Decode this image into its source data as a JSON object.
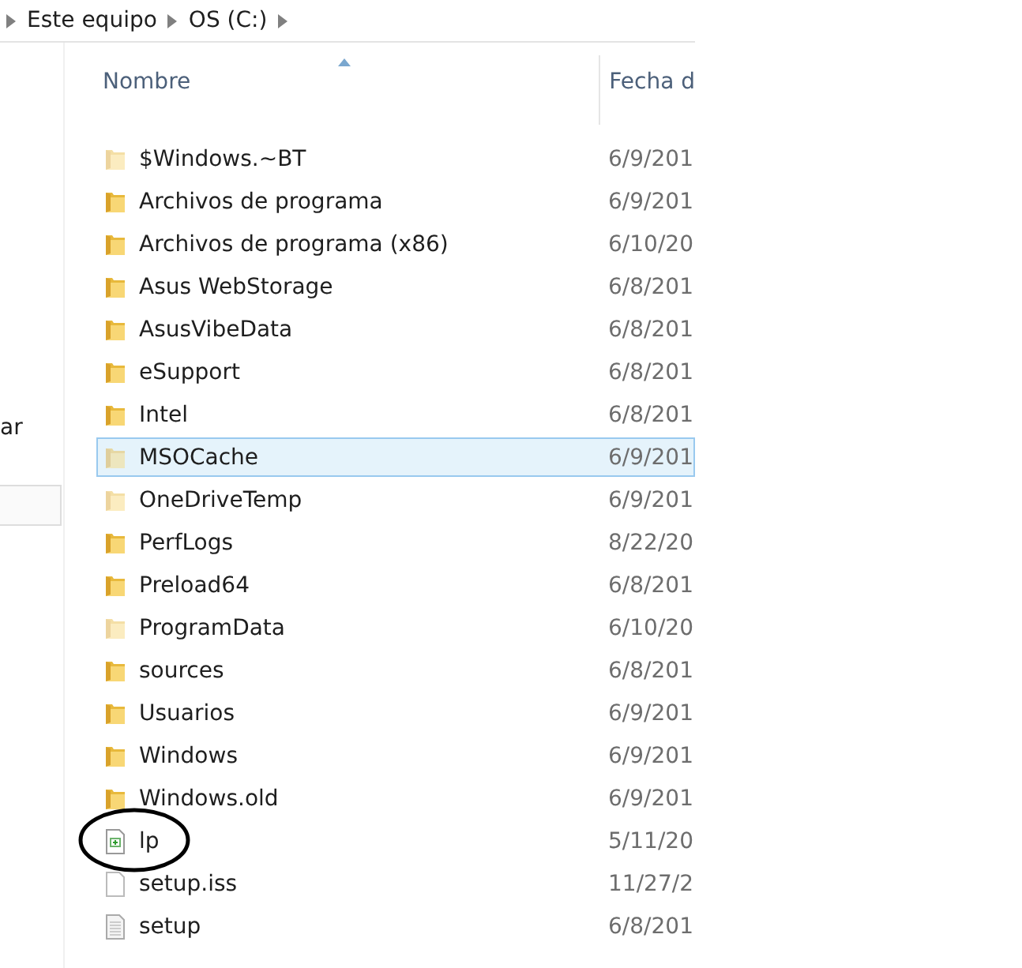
{
  "breadcrumb": [
    "Este equipo",
    "OS (C:)"
  ],
  "nav_pane": {
    "item_label": "ar"
  },
  "columns": [
    "Nombre",
    "Fecha d"
  ],
  "rows": [
    {
      "name": "$Windows.~BT",
      "date": "6/9/201",
      "kind": "folder",
      "hidden": true,
      "selected": false
    },
    {
      "name": "Archivos de programa",
      "date": "6/9/201",
      "kind": "folder",
      "hidden": false,
      "selected": false
    },
    {
      "name": "Archivos de programa (x86)",
      "date": "6/10/20",
      "kind": "folder",
      "hidden": false,
      "selected": false
    },
    {
      "name": "Asus WebStorage",
      "date": "6/8/201",
      "kind": "folder",
      "hidden": false,
      "selected": false
    },
    {
      "name": "AsusVibeData",
      "date": "6/8/201",
      "kind": "folder",
      "hidden": false,
      "selected": false
    },
    {
      "name": "eSupport",
      "date": "6/8/201",
      "kind": "folder",
      "hidden": false,
      "selected": false
    },
    {
      "name": "Intel",
      "date": "6/8/201",
      "kind": "folder",
      "hidden": false,
      "selected": false
    },
    {
      "name": "MSOCache",
      "date": "6/9/201",
      "kind": "folder",
      "hidden": true,
      "selected": true
    },
    {
      "name": "OneDriveTemp",
      "date": "6/9/201",
      "kind": "folder",
      "hidden": true,
      "selected": false
    },
    {
      "name": "PerfLogs",
      "date": "8/22/20",
      "kind": "folder",
      "hidden": false,
      "selected": false
    },
    {
      "name": "Preload64",
      "date": "6/8/201",
      "kind": "folder",
      "hidden": false,
      "selected": false
    },
    {
      "name": "ProgramData",
      "date": "6/10/20",
      "kind": "folder",
      "hidden": true,
      "selected": false
    },
    {
      "name": "sources",
      "date": "6/8/201",
      "kind": "folder",
      "hidden": false,
      "selected": false
    },
    {
      "name": "Usuarios",
      "date": "6/9/201",
      "kind": "folder",
      "hidden": false,
      "selected": false
    },
    {
      "name": "Windows",
      "date": "6/9/201",
      "kind": "folder",
      "hidden": false,
      "selected": false
    },
    {
      "name": "Windows.old",
      "date": "6/9/201",
      "kind": "folder",
      "hidden": false,
      "selected": false
    },
    {
      "name": "lp",
      "date": "5/11/20",
      "kind": "document",
      "hidden": false,
      "selected": false,
      "circled": true
    },
    {
      "name": "setup.iss",
      "date": "11/27/2",
      "kind": "blank",
      "hidden": false,
      "selected": false
    },
    {
      "name": "setup",
      "date": "6/8/201",
      "kind": "text",
      "hidden": false,
      "selected": false
    }
  ]
}
